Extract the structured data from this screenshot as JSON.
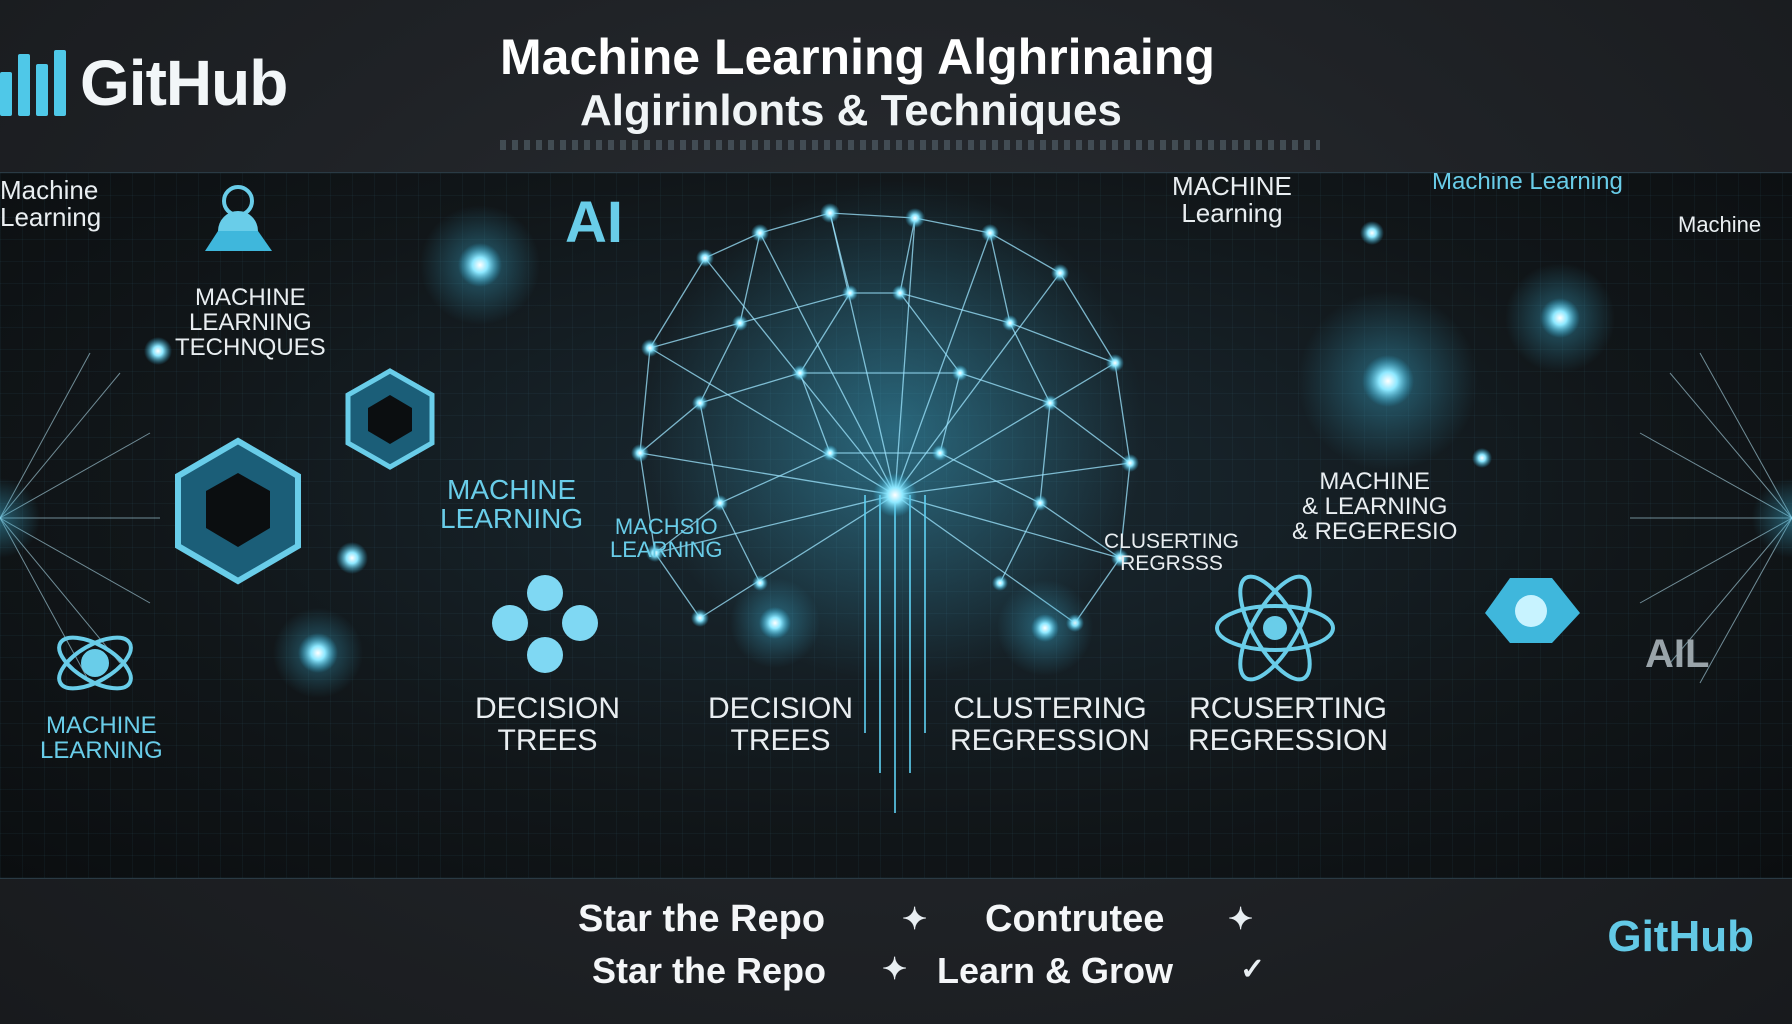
{
  "header": {
    "logo_text": "GitHub",
    "title_line1": "Machine Learning Alghrinaing",
    "title_line2": "Algirinlonts & Techniques"
  },
  "banner": {
    "labels": {
      "tl_machine_learning": "Machine\nLearning",
      "machine_learning_techniques": "MACHINE\nLEARNING\nTECHNQUES",
      "ai": "AI",
      "machine_learning_mid": "MACHINE\nLEARNING",
      "machsio_learning": "MACHSIO\nLEARNING",
      "machine_learning_top_right": "MACHINE\nLearning",
      "machine_learning_right": "Machine Learning",
      "machine_far_right": "Machine",
      "machine_learning_regression": "MACHINE\n& LEARNING\n& REGERESIO",
      "clusterting_regrsss": "CLUSERTING\nREGRSSS",
      "machine_learning_bl": "MACHINE\nLEARNING",
      "decision_trees_1": "DECISION\nTREES",
      "decision_trees_2": "DECISION\nTREES",
      "clustering_regression": "CLUSTERING\nREGRESSION",
      "rcuserting_regression": "RCUSERTING\nREGRESSION",
      "ail": "AIL"
    }
  },
  "footer": {
    "line1_left": "Star the Repo",
    "line1_right": "Contrutee",
    "line2_left": "Star the Repo",
    "line2_right": "Learn & Grow",
    "logo_text": "GitHub"
  },
  "colors": {
    "accent": "#4fc8e8",
    "background": "#1f2226",
    "glow": "#7fe3ff"
  },
  "icons": [
    "logo-bars-icon",
    "star-icon",
    "neural-brain-icon",
    "hexagon-icon",
    "atom-icon"
  ]
}
